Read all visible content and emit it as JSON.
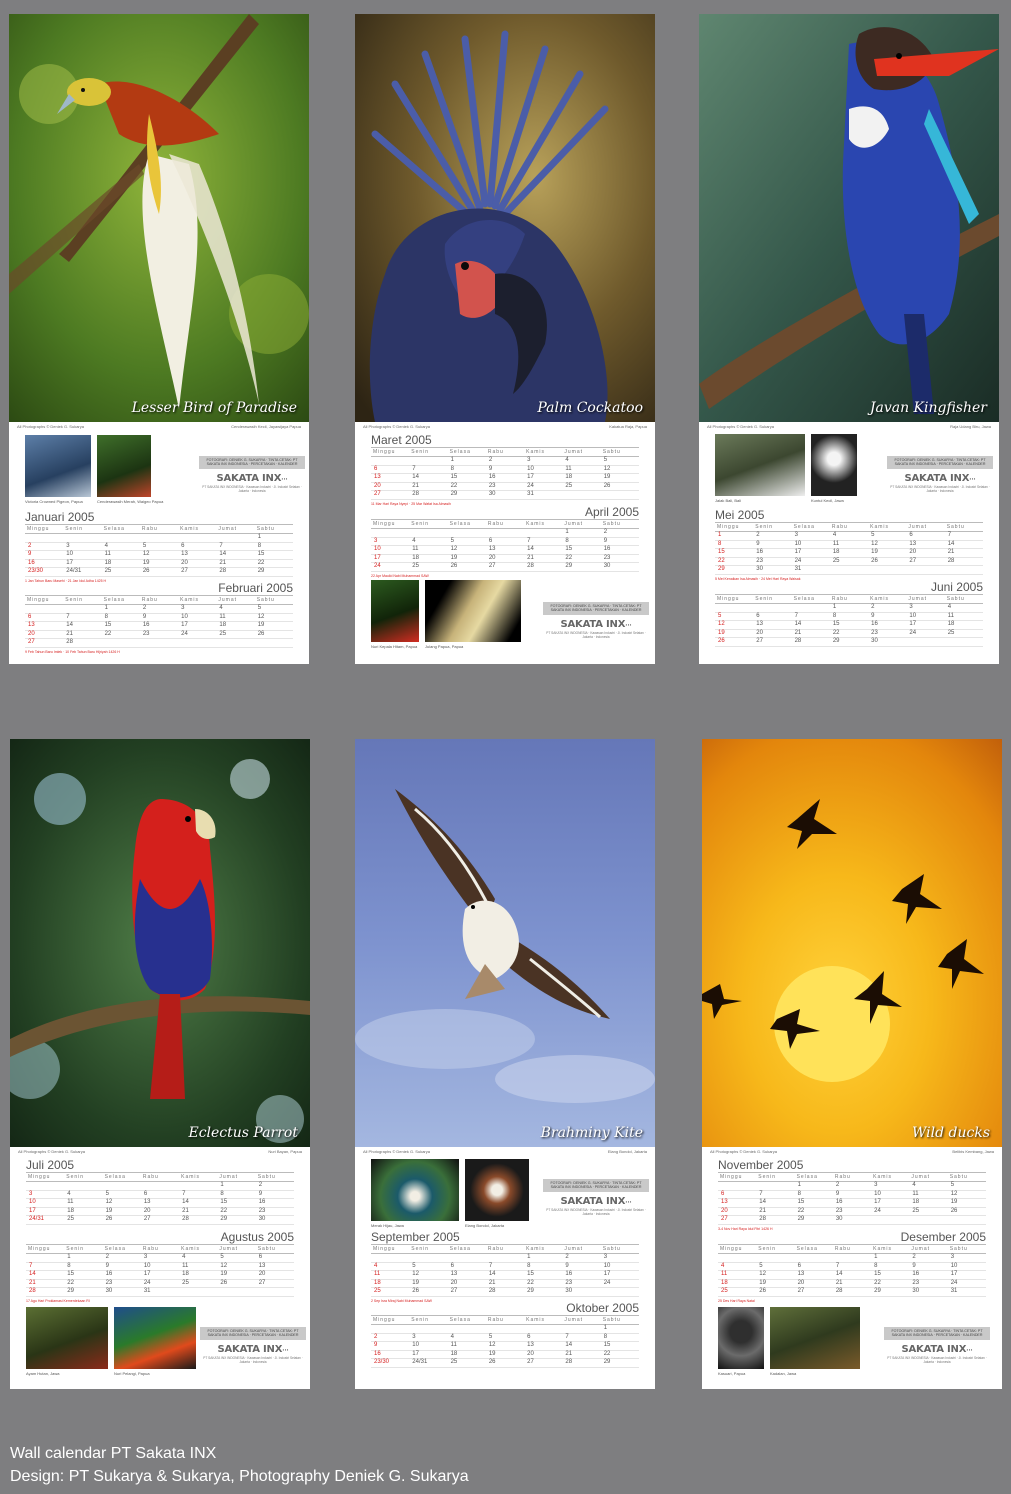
{
  "footer": {
    "line1": "Wall calendar PT Sakata INX",
    "line2": "Design: PT Sukarya & Sukarya,  Photography Deniek G. Sukarya"
  },
  "weekdays": [
    "Minggu",
    "Senin",
    "Selasa",
    "Rabu",
    "Kamis",
    "Jumat",
    "Sabtu"
  ],
  "logo": {
    "box": "FOTOGRAFI: DENIEK G. SUKARYA · TINTA CETAK: PT SAKATA INX INDONESIA · PERCETAKAN · KALENDER",
    "brand": "SAKATA INX",
    "address": "PT SAKATA INX INDONESIA · Kawasan Industri · Jl. Industri Selatan · Jakarta · Indonesia"
  },
  "colors": {
    "background": "#7e7e80",
    "holiday": "#d62020"
  },
  "sheets": [
    {
      "title": "Lesser Bird of Paradise",
      "credit_left": "All Photographs © Deniek G. Sukarya",
      "credit_right": "Cenderawasih Kecil, Jayawijaya Papua",
      "thumbs": [
        "Victoria Crowned Pigeon, Papua",
        "Cenderawasih Merah, Waigeo Papua"
      ],
      "months": [
        {
          "name": "Januari 2005",
          "weeks": [
            [
              "",
              "",
              "",
              "",
              "",
              "",
              "1"
            ],
            [
              "2",
              "3",
              "4",
              "5",
              "6",
              "7",
              "8"
            ],
            [
              "9",
              "10",
              "11",
              "12",
              "13",
              "14",
              "15"
            ],
            [
              "16",
              "17",
              "18",
              "19",
              "20",
              "21",
              "22"
            ],
            [
              "23/30",
              "24/31",
              "25",
              "26",
              "27",
              "28",
              "29"
            ]
          ],
          "note": "1 Jan Tahun Baru Masehi · 21 Jan Idul Adha 1425 H"
        },
        {
          "name": "Februari 2005",
          "weeks": [
            [
              "",
              "",
              "1",
              "2",
              "3",
              "4",
              "5"
            ],
            [
              "6",
              "7",
              "8",
              "9",
              "10",
              "11",
              "12"
            ],
            [
              "13",
              "14",
              "15",
              "16",
              "17",
              "18",
              "19"
            ],
            [
              "20",
              "21",
              "22",
              "23",
              "24",
              "25",
              "26"
            ],
            [
              "27",
              "28",
              "",
              "",
              "",
              "",
              ""
            ]
          ],
          "note": "9 Feb Tahun Baru Imlek · 10 Feb Tahun Baru Hijriyah 1426 H"
        }
      ]
    },
    {
      "title": "Palm Cockatoo",
      "credit_left": "All Photographs © Deniek G. Sukarya",
      "credit_right": "Kakatua Raja, Papua",
      "thumbs": [
        "Nuri Kepala Hitam, Papua",
        "Julang Papua, Papua"
      ],
      "months": [
        {
          "name": "Maret 2005",
          "weeks": [
            [
              "",
              "",
              "1",
              "2",
              "3",
              "4",
              "5"
            ],
            [
              "6",
              "7",
              "8",
              "9",
              "10",
              "11",
              "12"
            ],
            [
              "13",
              "14",
              "15",
              "16",
              "17",
              "18",
              "19"
            ],
            [
              "20",
              "21",
              "22",
              "23",
              "24",
              "25",
              "26"
            ],
            [
              "27",
              "28",
              "29",
              "30",
              "31",
              "",
              ""
            ]
          ],
          "note": "11 Mar Hari Raya Nyepi · 25 Mar Wafat Isa Almasih"
        },
        {
          "name": "April 2005",
          "weeks": [
            [
              "",
              "",
              "",
              "",
              "",
              "1",
              "2"
            ],
            [
              "3",
              "4",
              "5",
              "6",
              "7",
              "8",
              "9"
            ],
            [
              "10",
              "11",
              "12",
              "13",
              "14",
              "15",
              "16"
            ],
            [
              "17",
              "18",
              "19",
              "20",
              "21",
              "22",
              "23"
            ],
            [
              "24",
              "25",
              "26",
              "27",
              "28",
              "29",
              "30"
            ]
          ],
          "note": "22 Apr Maulid Nabi Muhammad SAW"
        }
      ]
    },
    {
      "title": "Javan Kingfisher",
      "credit_left": "All Photographs © Deniek G. Sukarya",
      "credit_right": "Raja Udang Biru, Jawa",
      "thumbs": [
        "Jalak Bali, Bali",
        "Kuntul Kecil, Jawa"
      ],
      "months": [
        {
          "name": "Mei 2005",
          "weeks": [
            [
              "1",
              "2",
              "3",
              "4",
              "5",
              "6",
              "7"
            ],
            [
              "8",
              "9",
              "10",
              "11",
              "12",
              "13",
              "14"
            ],
            [
              "15",
              "16",
              "17",
              "18",
              "19",
              "20",
              "21"
            ],
            [
              "22",
              "23",
              "24",
              "25",
              "26",
              "27",
              "28"
            ],
            [
              "29",
              "30",
              "31",
              "",
              "",
              "",
              ""
            ]
          ],
          "note": "5 Mei Kenaikan Isa Almasih · 24 Mei Hari Raya Waisak"
        },
        {
          "name": "Juni 2005",
          "weeks": [
            [
              "",
              "",
              "",
              "1",
              "2",
              "3",
              "4"
            ],
            [
              "5",
              "6",
              "7",
              "8",
              "9",
              "10",
              "11"
            ],
            [
              "12",
              "13",
              "14",
              "15",
              "16",
              "17",
              "18"
            ],
            [
              "19",
              "20",
              "21",
              "22",
              "23",
              "24",
              "25"
            ],
            [
              "26",
              "27",
              "28",
              "29",
              "30",
              "",
              ""
            ]
          ],
          "note": ""
        }
      ]
    },
    {
      "title": "Eclectus Parrot",
      "credit_left": "All Photographs © Deniek G. Sukarya",
      "credit_right": "Nuri Bayan, Papua",
      "thumbs": [
        "Ayam Hutan, Jawa",
        "Nuri Pelangi, Papua"
      ],
      "months": [
        {
          "name": "Juli 2005",
          "weeks": [
            [
              "",
              "",
              "",
              "",
              "",
              "1",
              "2"
            ],
            [
              "3",
              "4",
              "5",
              "6",
              "7",
              "8",
              "9"
            ],
            [
              "10",
              "11",
              "12",
              "13",
              "14",
              "15",
              "16"
            ],
            [
              "17",
              "18",
              "19",
              "20",
              "21",
              "22",
              "23"
            ],
            [
              "24/31",
              "25",
              "26",
              "27",
              "28",
              "29",
              "30"
            ]
          ],
          "note": ""
        },
        {
          "name": "Agustus 2005",
          "weeks": [
            [
              "",
              "1",
              "2",
              "3",
              "4",
              "5",
              "6"
            ],
            [
              "7",
              "8",
              "9",
              "10",
              "11",
              "12",
              "13"
            ],
            [
              "14",
              "15",
              "16",
              "17",
              "18",
              "19",
              "20"
            ],
            [
              "21",
              "22",
              "23",
              "24",
              "25",
              "26",
              "27"
            ],
            [
              "28",
              "29",
              "30",
              "31",
              "",
              "",
              ""
            ]
          ],
          "note": "17 Agu Hari Proklamasi Kemerdekaan RI"
        }
      ]
    },
    {
      "title": "Brahminy Kite",
      "credit_left": "All Photographs © Deniek G. Sukarya",
      "credit_right": "Elang Bondol, Jakarta",
      "thumbs": [
        "Merak Hijau, Jawa",
        "Elang Bondol, Jakarta"
      ],
      "months": [
        {
          "name": "September 2005",
          "weeks": [
            [
              "",
              "",
              "",
              "",
              "1",
              "2",
              "3"
            ],
            [
              "4",
              "5",
              "6",
              "7",
              "8",
              "9",
              "10"
            ],
            [
              "11",
              "12",
              "13",
              "14",
              "15",
              "16",
              "17"
            ],
            [
              "18",
              "19",
              "20",
              "21",
              "22",
              "23",
              "24"
            ],
            [
              "25",
              "26",
              "27",
              "28",
              "29",
              "30",
              ""
            ]
          ],
          "note": "2 Sep Isra Miraj Nabi Muhammad SAW"
        },
        {
          "name": "Oktober 2005",
          "weeks": [
            [
              "",
              "",
              "",
              "",
              "",
              "",
              "1"
            ],
            [
              "2",
              "3",
              "4",
              "5",
              "6",
              "7",
              "8"
            ],
            [
              "9",
              "10",
              "11",
              "12",
              "13",
              "14",
              "15"
            ],
            [
              "16",
              "17",
              "18",
              "19",
              "20",
              "21",
              "22"
            ],
            [
              "23/30",
              "24/31",
              "25",
              "26",
              "27",
              "28",
              "29"
            ]
          ],
          "note": ""
        }
      ]
    },
    {
      "title": "Wild ducks",
      "credit_left": "All Photographs © Deniek G. Sukarya",
      "credit_right": "Belibis Kembang, Jawa",
      "thumbs": [
        "Kasuari, Papua",
        "Kadalan, Jawa"
      ],
      "months": [
        {
          "name": "November 2005",
          "weeks": [
            [
              "",
              "",
              "1",
              "2",
              "3",
              "4",
              "5"
            ],
            [
              "6",
              "7",
              "8",
              "9",
              "10",
              "11",
              "12"
            ],
            [
              "13",
              "14",
              "15",
              "16",
              "17",
              "18",
              "19"
            ],
            [
              "20",
              "21",
              "22",
              "23",
              "24",
              "25",
              "26"
            ],
            [
              "27",
              "28",
              "29",
              "30",
              "",
              "",
              ""
            ]
          ],
          "note": "3-4 Nov Hari Raya Idul Fitri 1426 H"
        },
        {
          "name": "Desember 2005",
          "weeks": [
            [
              "",
              "",
              "",
              "",
              "1",
              "2",
              "3"
            ],
            [
              "4",
              "5",
              "6",
              "7",
              "8",
              "9",
              "10"
            ],
            [
              "11",
              "12",
              "13",
              "14",
              "15",
              "16",
              "17"
            ],
            [
              "18",
              "19",
              "20",
              "21",
              "22",
              "23",
              "24"
            ],
            [
              "25",
              "26",
              "27",
              "28",
              "29",
              "30",
              "31"
            ]
          ],
          "note": "25 Des Hari Raya Natal"
        }
      ]
    }
  ]
}
